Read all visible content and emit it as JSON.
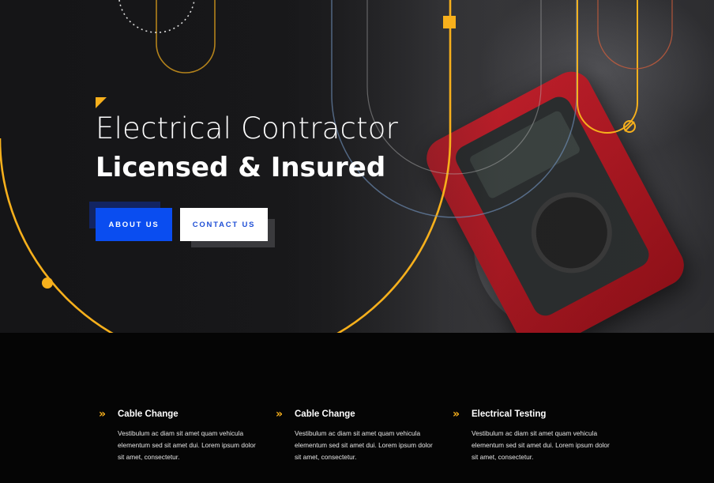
{
  "hero": {
    "title_line1": "Electrical Contractor",
    "title_line2": "Licensed & Insured",
    "about_button": "ABOUT US",
    "contact_button": "CONTACT US"
  },
  "features": [
    {
      "icon": "double-chevron-right-icon",
      "title": "Cable Change",
      "text": "Vestibulum ac diam sit amet quam vehicula elementum sed sit amet dui. Lorem ipsum dolor sit amet, consectetur."
    },
    {
      "icon": "double-chevron-right-icon",
      "title": "Cable Change",
      "text": "Vestibulum ac diam sit amet quam vehicula elementum sed sit amet dui. Lorem ipsum dolor sit amet, consectetur."
    },
    {
      "icon": "double-chevron-right-icon",
      "title": "Electrical Testing",
      "text": "Vestibulum ac diam sit amet quam vehicula elementum sed sit amet dui. Lorem ipsum dolor sit amet, consectetur."
    }
  ],
  "colors": {
    "accent": "#f7b01c",
    "primary_button": "#0a4df0",
    "background": "#050505"
  }
}
